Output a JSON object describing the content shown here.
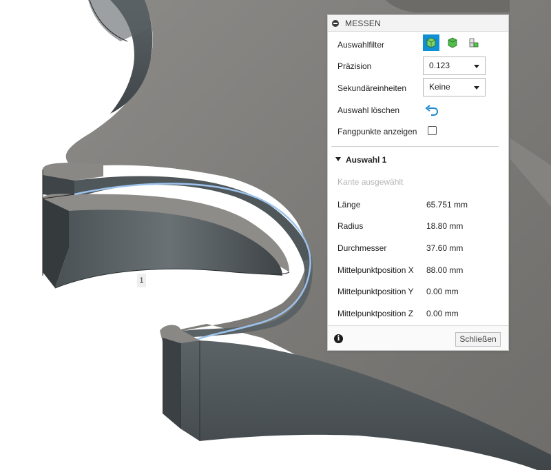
{
  "viewport": {
    "marker_label": "1",
    "colors": {
      "body": "#7d7b78",
      "wall": "#4d5457",
      "highlight": "#8ab6e8"
    }
  },
  "panel": {
    "title": "MESSEN",
    "rows": {
      "selection_filter": {
        "label": "Auswahlfilter",
        "buttons": [
          "body-filter-icon",
          "face-filter-icon",
          "edge-filter-icon"
        ],
        "active_index": 0
      },
      "precision": {
        "label": "Präzision",
        "value": "0.123"
      },
      "secondary_units": {
        "label": "Sekundäreinheiten",
        "value": "Keine"
      },
      "clear_selection": {
        "label": "Auswahl löschen",
        "icon": "undo-icon"
      },
      "show_snap_points": {
        "label": "Fangpunkte anzeigen",
        "checked": false
      }
    },
    "selection": {
      "title": "Auswahl 1",
      "hint": "Kante ausgewählt",
      "measurements": [
        {
          "label": "Länge",
          "value": "65.751 mm"
        },
        {
          "label": "Radius",
          "value": "18.80 mm"
        },
        {
          "label": "Durchmesser",
          "value": "37.60 mm"
        },
        {
          "label": "Mittelpunktposition X",
          "value": "88.00 mm"
        },
        {
          "label": "Mittelpunktposition Y",
          "value": "0.00 mm"
        },
        {
          "label": "Mittelpunktposition Z",
          "value": "0.00 mm"
        }
      ]
    },
    "footer": {
      "info_icon": "info-icon",
      "close_label": "Schließen"
    },
    "accent_color": "#0f8fd4"
  }
}
